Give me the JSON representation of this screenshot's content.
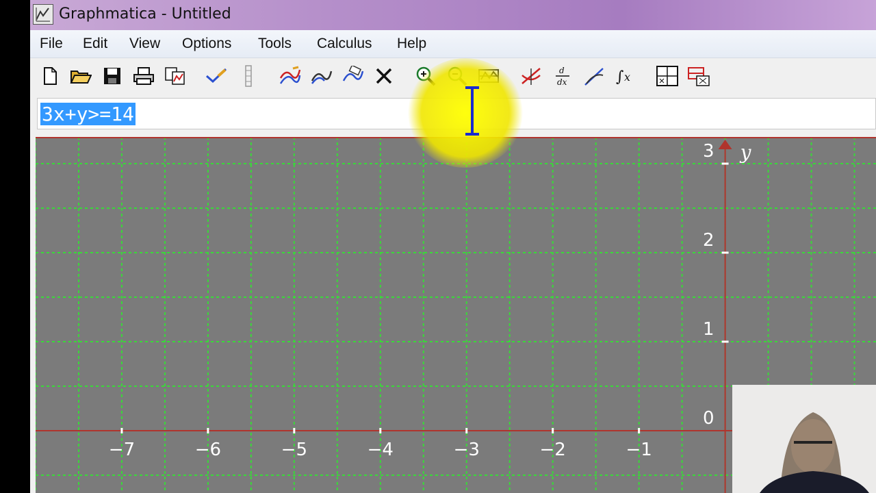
{
  "window": {
    "title": "Graphmatica - Untitled",
    "icon": "graphmatica-app-icon"
  },
  "menu": {
    "items": [
      "File",
      "Edit",
      "View",
      "Options",
      "Tools",
      "Calculus",
      "Help"
    ]
  },
  "toolbar": {
    "buttons": [
      {
        "icon": "new-file-icon"
      },
      {
        "icon": "open-folder-icon"
      },
      {
        "icon": "save-icon"
      },
      {
        "icon": "print-icon"
      },
      {
        "icon": "copy-graph-icon"
      },
      {
        "icon": "check-edit-icon"
      },
      {
        "icon": "separator-grip-icon"
      },
      {
        "icon": "graph-curve-icon"
      },
      {
        "icon": "redraw-icon"
      },
      {
        "icon": "erase-curve-icon"
      },
      {
        "icon": "delete-x-icon"
      },
      {
        "icon": "zoom-in-icon"
      },
      {
        "icon": "zoom-out-icon"
      },
      {
        "icon": "zoom-box-icon"
      },
      {
        "icon": "intersection-icon"
      },
      {
        "icon": "derivative-icon"
      },
      {
        "icon": "tangent-icon"
      },
      {
        "icon": "integral-icon"
      },
      {
        "icon": "table-of-values-icon"
      },
      {
        "icon": "data-plot-icon"
      }
    ]
  },
  "equation_input": {
    "value": "3x+y>=14"
  },
  "graph": {
    "background": "#7b7b7b",
    "grid_color": "#39d939",
    "axis_color": "#b0342d",
    "shade_color": "#a352a6",
    "y_axis_label": "y",
    "x_ticks": [
      "−7",
      "−6",
      "−5",
      "−4",
      "−3",
      "−2",
      "−1"
    ],
    "y_ticks": [
      "3",
      "2",
      "1",
      "0"
    ],
    "x_range": [
      -8.0,
      1.75
    ],
    "y_range": [
      -0.7,
      3.3
    ],
    "inequality": "3x+y>=14"
  },
  "colors": {
    "highlight": "#ffff00",
    "selection": "#3399ff"
  }
}
